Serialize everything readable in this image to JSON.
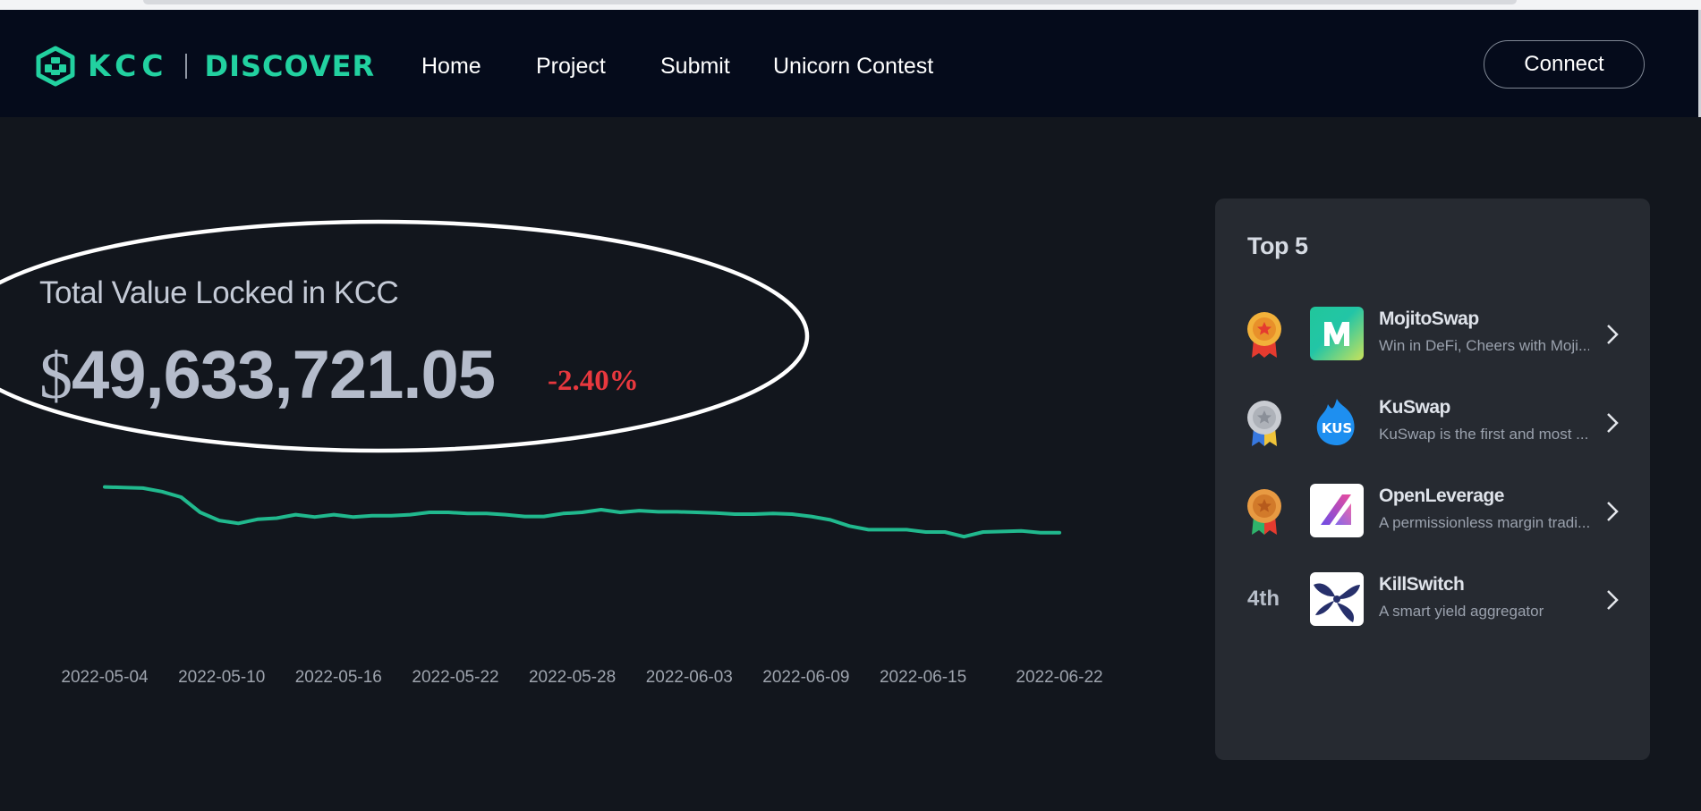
{
  "header": {
    "logo_text": "KCC",
    "logo_sub": "DISCOVER",
    "nav": [
      "Home",
      "Project",
      "Submit",
      "Unicorn Contest"
    ],
    "connect_label": "Connect"
  },
  "tvl": {
    "title": "Total Value Locked in KCC",
    "currency": "$",
    "value": "49,633,721.05",
    "change": "-2.40%",
    "change_color": "#e8383e",
    "accent": "#21b98e"
  },
  "chart_data": {
    "type": "line",
    "x_ticks": [
      "2022-05-04",
      "2022-05-10",
      "2022-05-16",
      "2022-05-22",
      "2022-05-28",
      "2022-06-03",
      "2022-06-09",
      "2022-06-15",
      "2022-06-22"
    ],
    "x_start": "2022-05-04",
    "x_end": "2022-06-22",
    "series": [
      {
        "color": "#21b98e",
        "values": [
          1.0,
          0.997,
          0.994,
          0.976,
          0.947,
          0.868,
          0.826,
          0.811,
          0.832,
          0.838,
          0.856,
          0.844,
          0.856,
          0.844,
          0.851,
          0.851,
          0.856,
          0.868,
          0.868,
          0.862,
          0.862,
          0.856,
          0.847,
          0.847,
          0.862,
          0.868,
          0.882,
          0.868,
          0.877,
          0.871,
          0.871,
          0.868,
          0.865,
          0.859,
          0.859,
          0.862,
          0.859,
          0.847,
          0.829,
          0.797,
          0.778,
          0.778,
          0.778,
          0.766,
          0.766,
          0.742,
          0.766,
          0.769,
          0.772,
          0.763,
          0.763
        ]
      }
    ],
    "ylim": [
      0,
      1.3
    ],
    "grid": false,
    "y_axis_visible": false
  },
  "top5": {
    "title": "Top 5",
    "items": [
      {
        "rank": "1st",
        "medal": "gold-medal-icon",
        "name": "MojitoSwap",
        "desc": "Win in DeFi, Cheers with Moji...",
        "logo": "mojitoswap-logo-icon"
      },
      {
        "rank": "2nd",
        "medal": "silver-medal-icon",
        "name": "KuSwap",
        "desc": "KuSwap is the first and most ...",
        "logo": "kuswap-logo-icon"
      },
      {
        "rank": "3rd",
        "medal": "bronze-medal-icon",
        "name": "OpenLeverage",
        "desc": "A permissionless margin tradi...",
        "logo": "openleverage-logo-icon"
      },
      {
        "rank": "4th",
        "medal": "",
        "name": "KillSwitch",
        "desc": "A smart yield aggregator",
        "logo": "killswitch-logo-icon"
      }
    ]
  }
}
